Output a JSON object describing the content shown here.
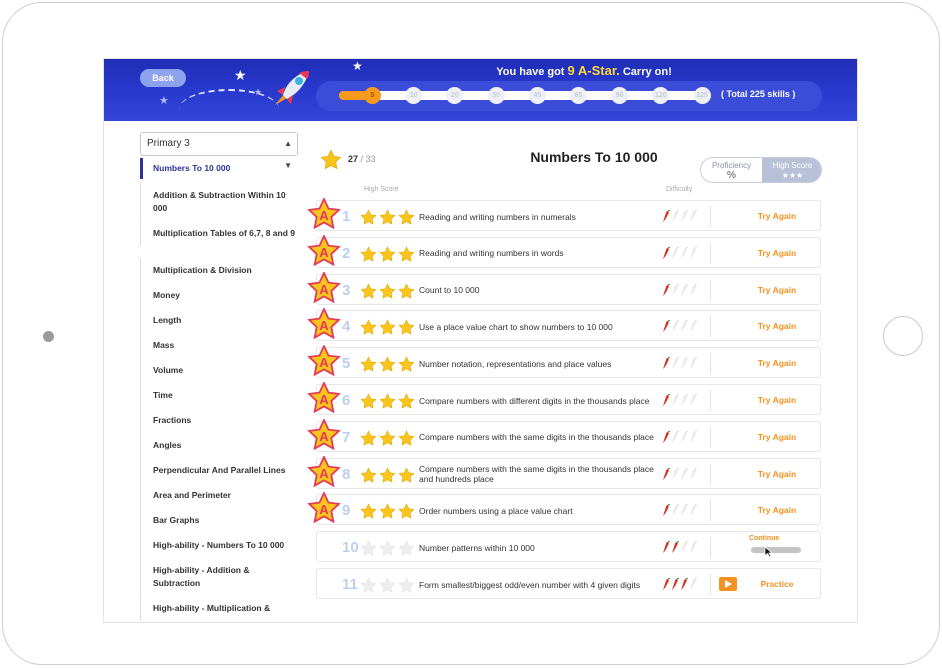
{
  "header": {
    "back_label": "Back",
    "message_prefix": "You have got",
    "message_highlight": "9 A-Star.",
    "message_suffix": "Carry on!",
    "milestones": [
      "5",
      "10",
      "20",
      "30",
      "45",
      "65",
      "90",
      "120",
      "225"
    ],
    "progress_fraction": 0.1,
    "total_label": "( Total 225 skills )"
  },
  "sidebar": {
    "grade": "Primary 3",
    "items": [
      "Numbers To 10 000",
      "Addition & Subtraction Within 10 000",
      "Multiplication Tables of 6,7, 8 and 9",
      "Multiplication & Division",
      "Money",
      "Length",
      "Mass",
      "Volume",
      "Time",
      "Fractions",
      "Angles",
      "Perpendicular And Parallel Lines",
      "Area and Perimeter",
      "Bar Graphs",
      "High-ability - Numbers To 10 000",
      "High-ability - Addition & Subtraction",
      "High-ability - Multiplication &"
    ]
  },
  "main": {
    "star_count": "27",
    "star_total": "/ 33",
    "title": "Numbers To 10 000",
    "toggle_left": "Proficiency",
    "toggle_left_sub": "%",
    "toggle_right": "High Score",
    "toggle_right_sub": "★★★",
    "col_high_score": "High Score",
    "col_difficulty": "Difficulty",
    "badge_letter": "A",
    "skills": [
      {
        "num": "1",
        "text": "Reading and writing numbers in numerals",
        "stars": 3,
        "difficulty": 1,
        "astar": true,
        "action": "Try Again"
      },
      {
        "num": "2",
        "text": "Reading and writing numbers in words",
        "stars": 3,
        "difficulty": 1,
        "astar": true,
        "action": "Try Again"
      },
      {
        "num": "3",
        "text": "Count to 10 000",
        "stars": 3,
        "difficulty": 1,
        "astar": true,
        "action": "Try Again"
      },
      {
        "num": "4",
        "text": "Use a place value chart to show numbers to 10 000",
        "stars": 3,
        "difficulty": 1,
        "astar": true,
        "action": "Try Again"
      },
      {
        "num": "5",
        "text": "Number notation, representations and place values",
        "stars": 3,
        "difficulty": 1,
        "astar": true,
        "action": "Try Again"
      },
      {
        "num": "6",
        "text": "Compare numbers with different digits in the thousands place",
        "stars": 3,
        "difficulty": 1,
        "astar": true,
        "action": "Try Again"
      },
      {
        "num": "7",
        "text": "Compare numbers with the same digits in the thousands place",
        "stars": 3,
        "difficulty": 1,
        "astar": true,
        "action": "Try Again"
      },
      {
        "num": "8",
        "text": "Compare numbers with the same digits in the thousands place and hundreds place",
        "stars": 3,
        "difficulty": 1,
        "astar": true,
        "action": "Try Again"
      },
      {
        "num": "9",
        "text": "Order numbers using a place value chart",
        "stars": 3,
        "difficulty": 1,
        "astar": true,
        "action": "Try Again"
      },
      {
        "num": "10",
        "text": "Number patterns within 10 000",
        "stars": 0,
        "difficulty": 2,
        "astar": false,
        "action": "Continue"
      },
      {
        "num": "11",
        "text": "Form smallest/biggest odd/even number with 4 given digits",
        "stars": 0,
        "difficulty": 3,
        "astar": false,
        "action": "Practice"
      }
    ]
  },
  "colors": {
    "header_blue": "#2a3ad0",
    "accent_orange": "#f39220",
    "star_yellow": "#f7c51b",
    "active_nav": "#2b3494",
    "chili_red": "#d62b1f"
  }
}
